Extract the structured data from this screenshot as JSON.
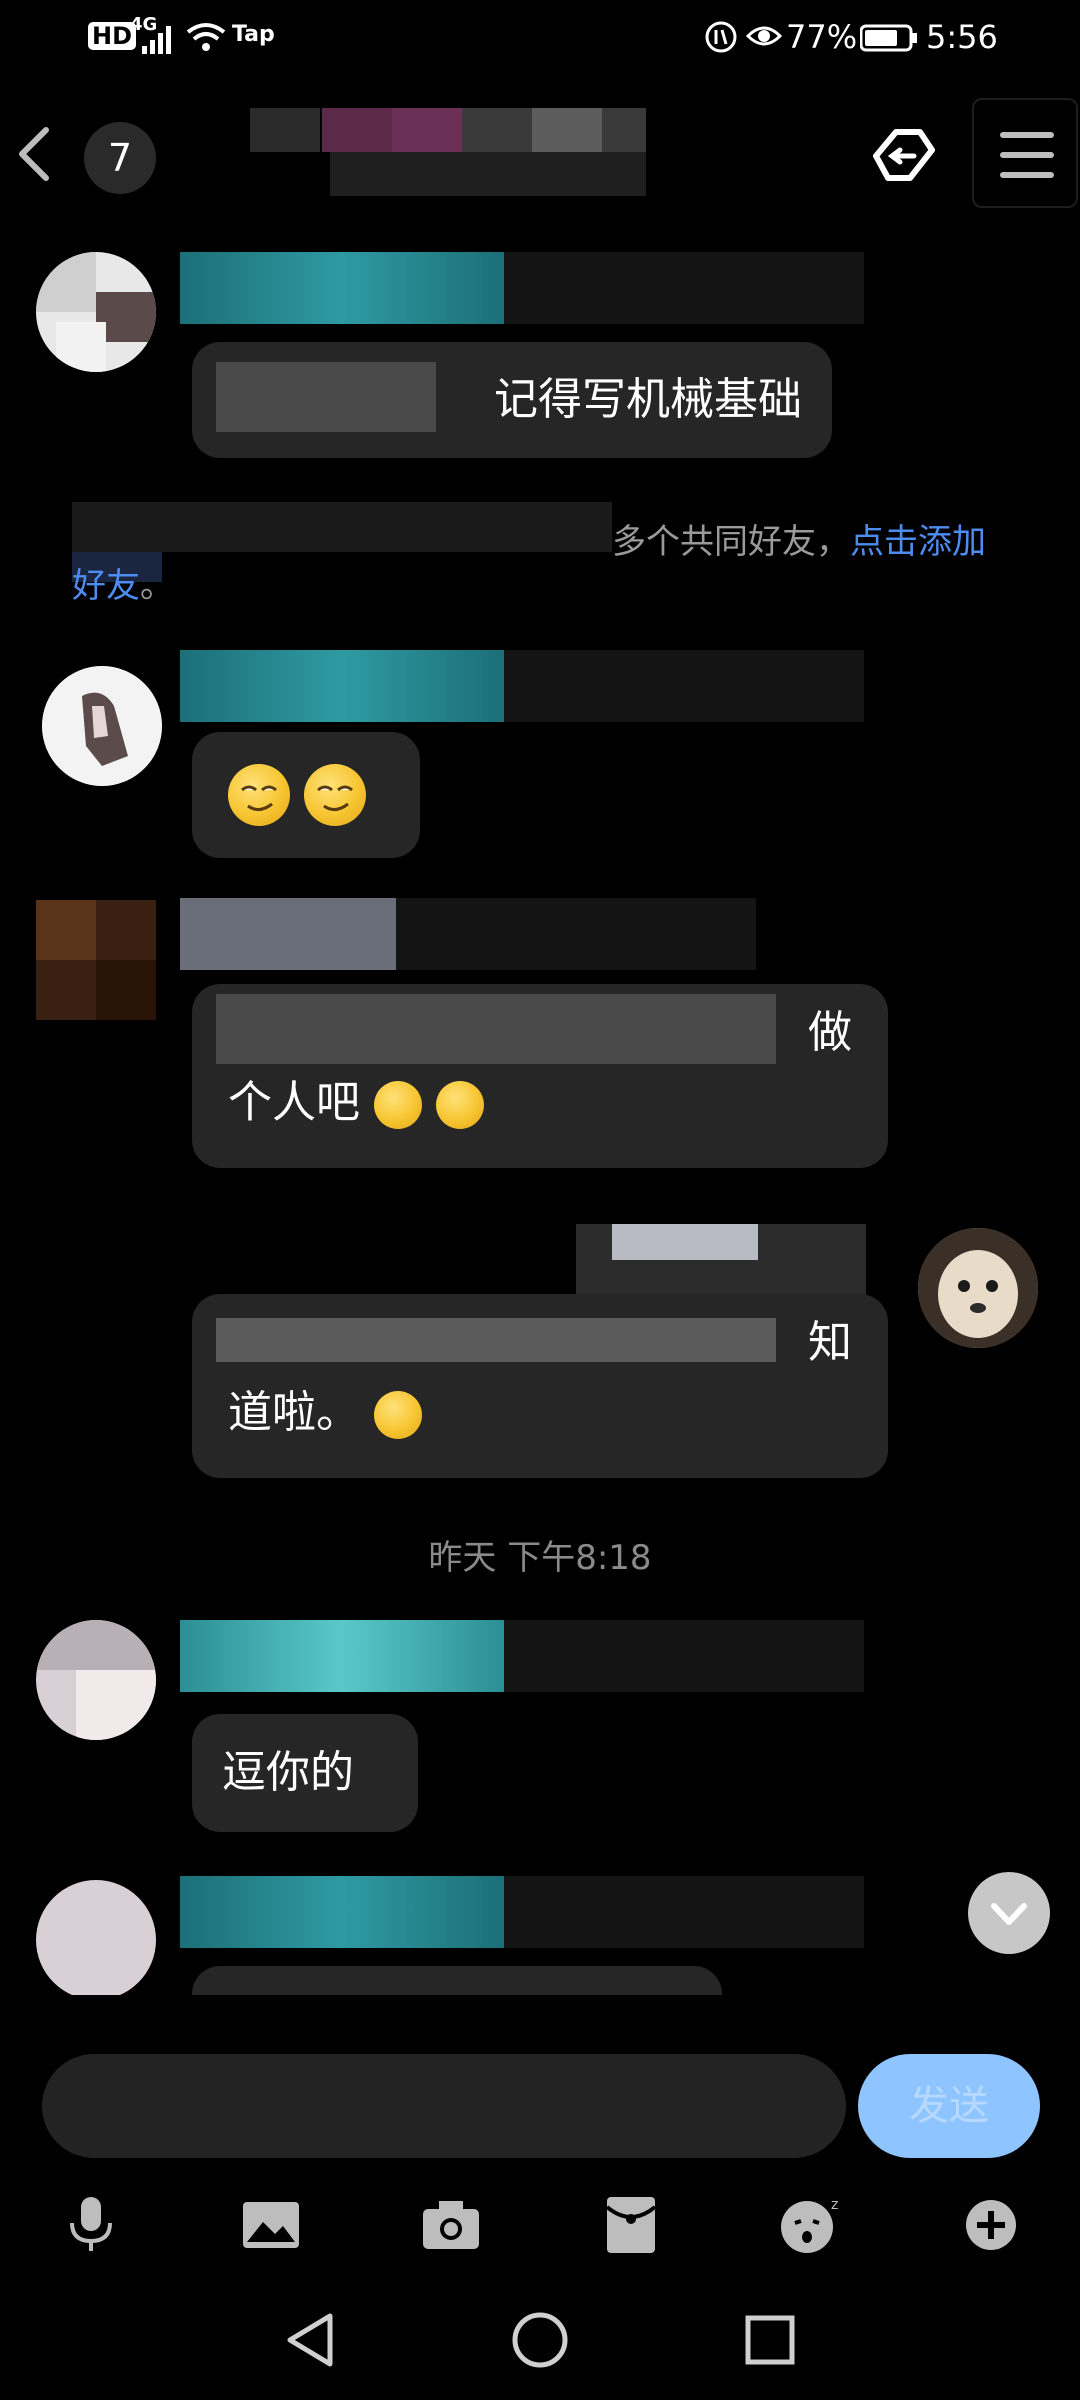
{
  "status_bar": {
    "hd": "HD",
    "network": "4G",
    "wifi_label": "Tap",
    "battery": "77%",
    "time": "5:56"
  },
  "header": {
    "unread_count": "7",
    "icons": [
      "back-icon",
      "sync-icon",
      "menu-icon"
    ]
  },
  "messages": [
    {
      "sender": "other",
      "text": "记得写机械基础"
    },
    {
      "sender": "other",
      "emojis": [
        "smirk-emoji",
        "smirk-emoji"
      ]
    },
    {
      "sender": "other",
      "text_line1": "做",
      "text_line2": "个人吧"
    },
    {
      "sender": "self",
      "text_line1": "知",
      "text_line2": "道啦。"
    },
    {
      "sender": "other",
      "text": "逗你的"
    }
  ],
  "system_notice": {
    "text": "多个共同好友，",
    "link": "点击添加",
    "link2": "好友",
    "tail": "。"
  },
  "time_separator": "昨天 下午8:18",
  "input": {
    "value": "",
    "send_label": "发送"
  },
  "toolbar": [
    "mic-icon",
    "image-icon",
    "camera-icon",
    "red-packet-icon",
    "emoji-icon",
    "plus-icon"
  ],
  "colors": {
    "background": "#000000",
    "bubble": "#262626",
    "link": "#4d8cf0",
    "send_button": "#8ec4ff"
  }
}
